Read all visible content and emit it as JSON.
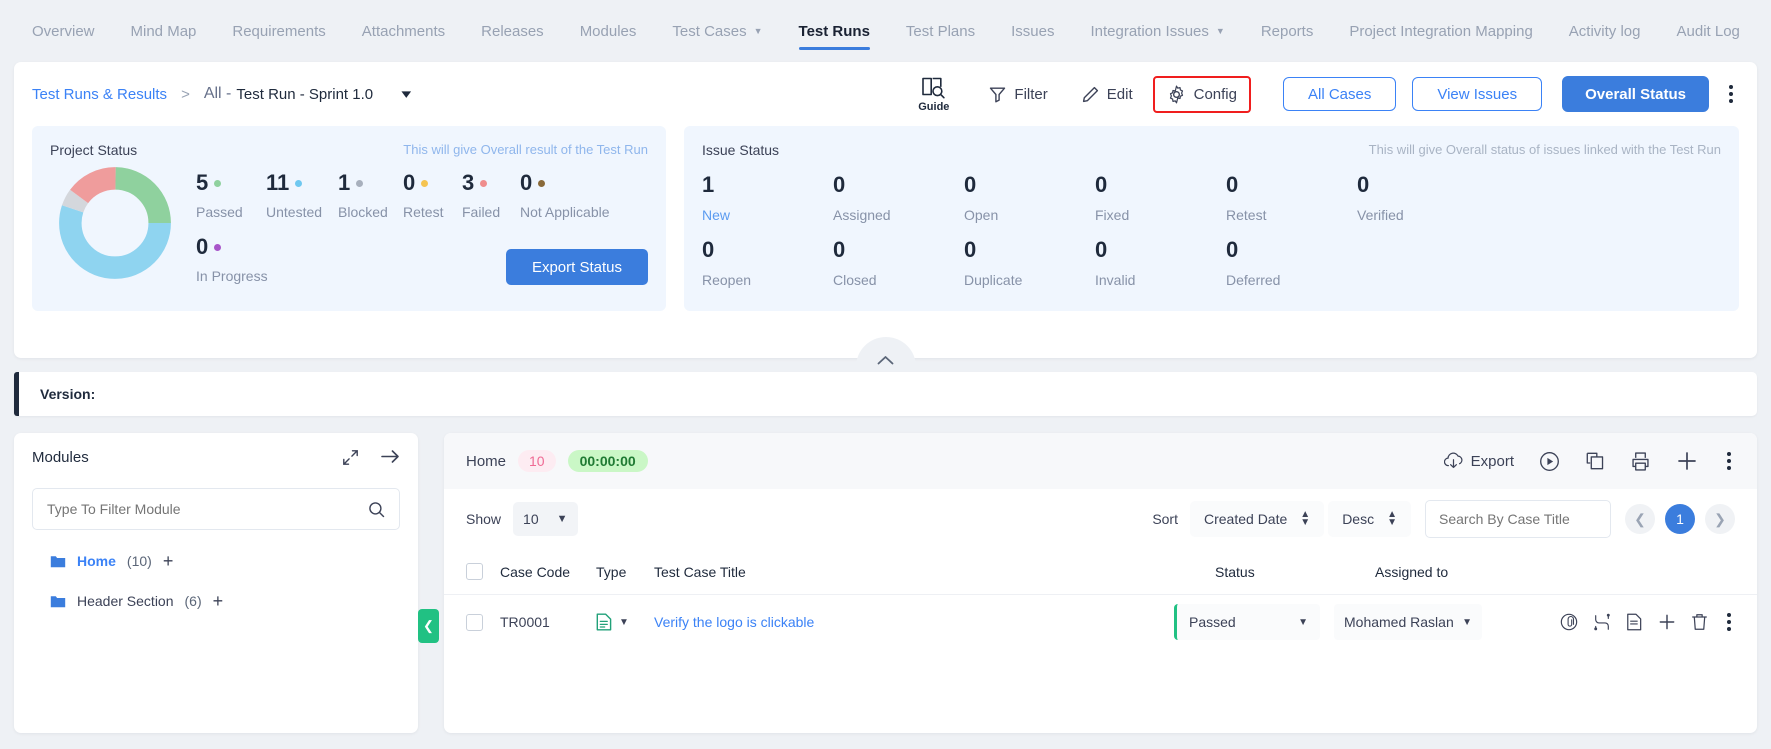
{
  "nav": {
    "items": [
      {
        "label": "Overview",
        "active": false,
        "caret": false
      },
      {
        "label": "Mind Map",
        "active": false,
        "caret": false
      },
      {
        "label": "Requirements",
        "active": false,
        "caret": false
      },
      {
        "label": "Attachments",
        "active": false,
        "caret": false
      },
      {
        "label": "Releases",
        "active": false,
        "caret": false
      },
      {
        "label": "Modules",
        "active": false,
        "caret": false
      },
      {
        "label": "Test Cases",
        "active": false,
        "caret": true
      },
      {
        "label": "Test Runs",
        "active": true,
        "caret": false
      },
      {
        "label": "Test Plans",
        "active": false,
        "caret": false
      },
      {
        "label": "Issues",
        "active": false,
        "caret": false
      },
      {
        "label": "Integration Issues",
        "active": false,
        "caret": true
      },
      {
        "label": "Reports",
        "active": false,
        "caret": false
      },
      {
        "label": "Project Integration Mapping",
        "active": false,
        "caret": false
      },
      {
        "label": "Activity log",
        "active": false,
        "caret": false
      },
      {
        "label": "Audit Log",
        "active": false,
        "caret": false
      }
    ]
  },
  "breadcrumb": {
    "root": "Test Runs & Results",
    "separator": ">",
    "scope": "All -",
    "name": "Test Run - Sprint 1.0"
  },
  "toolbar": {
    "guide_label": "Guide",
    "filter_label": "Filter",
    "edit_label": "Edit",
    "config_label": "Config",
    "all_cases_label": "All Cases",
    "view_issues_label": "View Issues",
    "overall_status_label": "Overall Status",
    "highlight_color": "#f01e1e"
  },
  "project_status": {
    "title": "Project Status",
    "note": "This will give Overall result of the Test Run",
    "export_label": "Export Status",
    "stats": [
      {
        "value": "5",
        "label": "Passed",
        "color": "#8fd19e"
      },
      {
        "value": "11",
        "label": "Untested",
        "color": "#6fc8f0"
      },
      {
        "value": "1",
        "label": "Blocked",
        "color": "#a8b0bd"
      },
      {
        "value": "0",
        "label": "Retest",
        "color": "#f5c451"
      },
      {
        "value": "3",
        "label": "Failed",
        "color": "#ef8d8d"
      },
      {
        "value": "0",
        "label": "Not Applicable",
        "color": "#8a6a3a"
      },
      {
        "value": "0",
        "label": "In Progress",
        "color": "#a855c9"
      }
    ]
  },
  "chart_data": {
    "type": "pie",
    "title": "Project Status",
    "labels": [
      "Passed",
      "Untested",
      "Blocked",
      "Retest",
      "Failed",
      "Not Applicable",
      "In Progress"
    ],
    "values": [
      5,
      11,
      1,
      0,
      3,
      0,
      0
    ],
    "colors": [
      "#8fd19e",
      "#8fd4f0",
      "#d4d7dc",
      "#f5c451",
      "#ef9c9c",
      "#8a6a3a",
      "#a855c9"
    ],
    "legend": "right",
    "donut": true
  },
  "issue_status": {
    "title": "Issue Status",
    "note": "This will give Overall status of issues linked with the Test Run",
    "row1": [
      {
        "value": "1",
        "label": "New",
        "accent": true
      },
      {
        "value": "0",
        "label": "Assigned",
        "accent": false
      },
      {
        "value": "0",
        "label": "Open",
        "accent": false
      },
      {
        "value": "0",
        "label": "Fixed",
        "accent": false
      },
      {
        "value": "0",
        "label": "Retest",
        "accent": false
      },
      {
        "value": "0",
        "label": "Verified",
        "accent": false
      }
    ],
    "row2": [
      {
        "value": "0",
        "label": "Reopen",
        "accent": false
      },
      {
        "value": "0",
        "label": "Closed",
        "accent": false
      },
      {
        "value": "0",
        "label": "Duplicate",
        "accent": false
      },
      {
        "value": "0",
        "label": "Invalid",
        "accent": false
      },
      {
        "value": "0",
        "label": "Deferred",
        "accent": false
      }
    ]
  },
  "version": {
    "label": "Version:"
  },
  "modules": {
    "title": "Modules",
    "filter_placeholder": "Type To Filter Module",
    "items": [
      {
        "name": "Home",
        "count": "(10)",
        "highlight": true
      },
      {
        "name": "Header Section",
        "count": "(6)",
        "highlight": false
      }
    ]
  },
  "cases": {
    "tab_label": "Home",
    "tab_count": "10",
    "timer": "00:00:00",
    "export_label": "Export",
    "show_label": "Show",
    "show_value": "10",
    "sort_label": "Sort",
    "sort_field": "Created Date",
    "sort_dir": "Desc",
    "search_placeholder": "Search By Case Title",
    "page_current": "1",
    "columns": [
      "Case Code",
      "Type",
      "Test Case Title",
      "Status",
      "Assigned to"
    ],
    "rows": [
      {
        "code": "TR0001",
        "title": "Verify the logo is clickable",
        "status": "Passed",
        "assigned": "Mohamed Raslan"
      }
    ]
  }
}
